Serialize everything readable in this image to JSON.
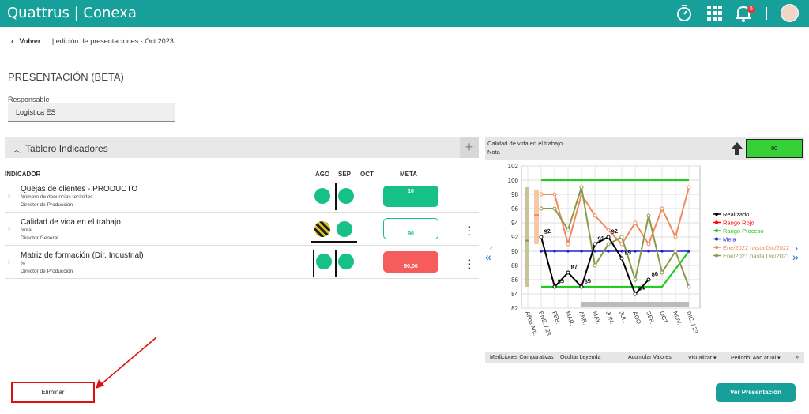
{
  "topbar": {
    "brand": "Quattrus | Conexa",
    "notifications": "5"
  },
  "breadcrumb": {
    "back": "Volver",
    "path": "edición de presentaciones - Oct 2023"
  },
  "page": {
    "title": "PRESENTACIÓN (BETA)"
  },
  "responsable": {
    "label": "Responsable",
    "value": "Logística ES"
  },
  "panel": {
    "title": "Tablero Indicadores",
    "headers": {
      "indicador": "INDICADOR",
      "ago": "AGO",
      "sep": "SEP",
      "oct": "OCT",
      "meta": "META"
    },
    "rows": [
      {
        "name": "Quejas de clientes - PRODUCTO",
        "sub1": "Número de denuncias recibidas",
        "sub2": "Director de Producción",
        "meta": "10"
      },
      {
        "name": "Calidad de vida en el trabajo",
        "sub1": "Nota",
        "sub2": "Director General",
        "meta": "90"
      },
      {
        "name": "Matriz de formación (Dir. Industrial)",
        "sub1": "%",
        "sub2": "Director de Producción",
        "meta": "90,00"
      }
    ]
  },
  "chart_panel": {
    "line1": "Calidad de vida en el trabajo",
    "line2": "Nota",
    "current_value": "90"
  },
  "chart_data": {
    "type": "line",
    "categories": [
      "Años Ant.",
      "ENE. / 23",
      "FEB.",
      "MAR.",
      "ABR.",
      "MAY.",
      "JUN.",
      "JUL.",
      "AGO.",
      "SEP.",
      "OCT.",
      "NOV.",
      "DIC. / 23"
    ],
    "ylim": [
      82,
      102
    ],
    "yticks": [
      82,
      84,
      86,
      88,
      90,
      92,
      94,
      96,
      98,
      100,
      102
    ],
    "series": [
      {
        "name": "Realizado",
        "color": "#000000",
        "values": [
          null,
          92,
          85,
          87,
          85,
          91,
          92,
          89,
          84,
          86,
          null,
          null,
          null
        ],
        "labels": [
          "",
          "92",
          "85",
          "87",
          "85",
          "91",
          "92",
          "89",
          "84",
          "86",
          "",
          "",
          ""
        ]
      },
      {
        "name": "Rango Rojo",
        "color": "#ff0000",
        "values": []
      },
      {
        "name": "Rango Proceso",
        "color": "#22cc22",
        "upper": [
          null,
          100,
          100,
          100,
          100,
          100,
          100,
          100,
          100,
          100,
          100,
          100,
          100
        ],
        "lower": [
          null,
          85,
          85,
          85,
          85,
          85,
          85,
          85,
          85,
          85,
          85,
          87.5,
          90
        ]
      },
      {
        "name": "Meta",
        "color": "#2222cc",
        "values": [
          null,
          90,
          90,
          90,
          90,
          90,
          90,
          90,
          90,
          90,
          90,
          90,
          90
        ]
      },
      {
        "name": "Ene/2022 hasta Dic/2022",
        "color": "#f08a5d",
        "values": [
          null,
          98,
          98,
          91,
          98,
          95,
          93,
          91,
          94,
          91,
          96,
          92,
          99
        ]
      },
      {
        "name": "Ene/2021 hasta Dic/2021",
        "color": "#8a9a4a",
        "values": [
          null,
          96,
          96,
          93,
          99,
          88,
          91,
          92,
          86,
          95,
          87,
          90,
          85
        ]
      }
    ],
    "legend_position": "right"
  },
  "chart_footer": [
    "Mediciones Comparativas",
    "Ocultar Leyenda",
    "Acumular Valores",
    "Visualizar ▾",
    "Periodo: Ano atual ▾",
    "»"
  ],
  "actions": {
    "eliminar": "Eliminar",
    "ver": "Ver Presentación"
  }
}
